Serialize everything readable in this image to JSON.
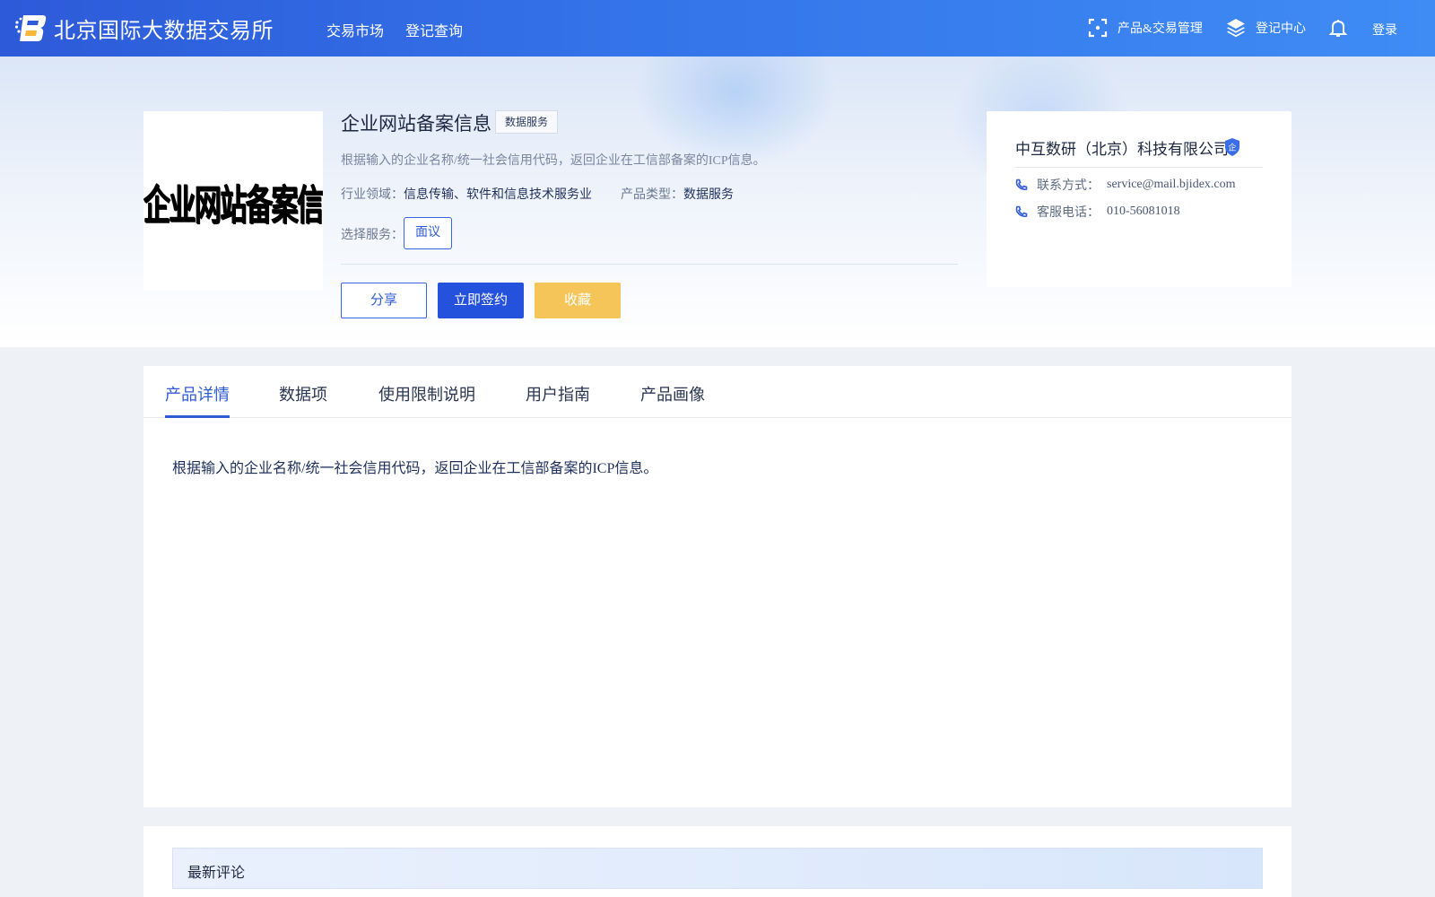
{
  "nav": {
    "site_name": "北京国际大数据交易所",
    "links": [
      "交易市场",
      "登记查询"
    ],
    "right_items": [
      {
        "label": "产品&交易管理",
        "icon": "scan-frame-icon"
      },
      {
        "label": "登记中心",
        "icon": "layers-icon"
      }
    ],
    "login_label": "登录"
  },
  "product": {
    "image_text": "企业网站备案信息",
    "title": "企业网站备案信息",
    "tag": "数据服务",
    "description": "根据输入的企业名称/统一社会信用代码，返回企业在工信部备案的ICP信息。",
    "industry_label": "行业领域：",
    "industry_value": "信息传输、软件和信息技术服务业",
    "type_label": "产品类型：",
    "type_value": "数据服务",
    "service_label": "选择服务：",
    "service_option": "面议",
    "buttons": {
      "share": "分享",
      "sign": "立即签约",
      "favorite": "收藏"
    }
  },
  "company": {
    "name": "中互数研（北京）科技有限公司",
    "badge_text": "企",
    "contact_label": "联系方式：",
    "contact_value": "service@mail.bjidex.com",
    "phone_label": "客服电话：",
    "phone_value": "010-56081018"
  },
  "tabs": {
    "items": [
      "产品详情",
      "数据项",
      "使用限制说明",
      "用户指南",
      "产品画像"
    ],
    "active_index": 0,
    "content": "根据输入的企业名称/统一社会信用代码，返回企业在工信部备案的ICP信息。"
  },
  "comments": {
    "title": "最新评论"
  },
  "colors": {
    "nav_gradient_start": "#2d5ad8",
    "nav_gradient_end": "#3f8cf5",
    "primary": "#2552dc",
    "favorite": "#f6c55a"
  }
}
